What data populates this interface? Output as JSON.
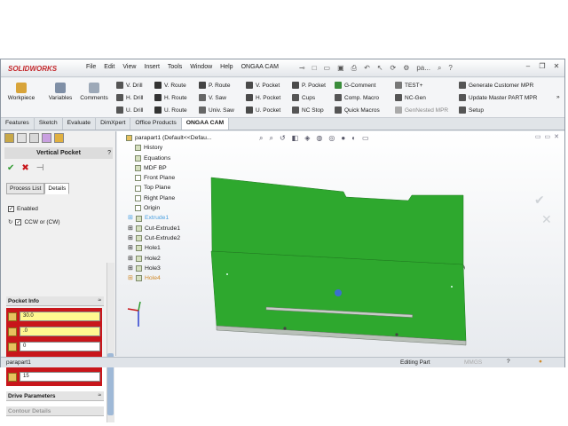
{
  "app": {
    "logo_text": "SOLIDWORKS",
    "doc_short": "pa..."
  },
  "menu": [
    "File",
    "Edit",
    "View",
    "Insert",
    "Tools",
    "Window",
    "Help",
    "ONGAA CAM"
  ],
  "ribbon": {
    "big": [
      {
        "label": "Workpiece",
        "icon": "workpiece-icon"
      },
      {
        "label": "Variables",
        "icon": "variables-icon"
      },
      {
        "label": "Comments",
        "icon": "comments-icon"
      }
    ],
    "col1": [
      "V. Drill",
      "H. Drill",
      "U. Drill"
    ],
    "col2": [
      "V. Route",
      "H. Route",
      "U. Route"
    ],
    "col3": [
      "P. Route",
      "V. Saw",
      "Univ. Saw"
    ],
    "col4": [
      "V. Pocket",
      "H. Pocket",
      "U. Pocket"
    ],
    "col5": [
      "P. Pocket",
      "Cups",
      "NC Stop"
    ],
    "col6": [
      "G-Comment",
      "Comp. Macro",
      "Quick Macros"
    ],
    "col7": [
      "TEST+",
      "NC-Gen",
      "GenNested MPR"
    ],
    "col8": [
      "Generate Customer MPR",
      "Update Master PART MPR",
      "Setup"
    ]
  },
  "tabs": [
    "Features",
    "Sketch",
    "Evaluate",
    "DimXpert",
    "Office Products",
    "ONGAA CAM"
  ],
  "panel": {
    "title": "Vertical Pocket",
    "help": "?",
    "subtabs": [
      "Process List",
      "Details"
    ],
    "enabled_label": "Enabled",
    "ccw_label": "CCW or (CW)",
    "pocket_info": "Pocket Info",
    "fields": [
      "30.0",
      ".0",
      "0",
      "80",
      "15"
    ],
    "drive_params": "Drive Parameters",
    "contour_details": "Contour Details"
  },
  "tree": {
    "root": "parapart1  (Default<<Defau...",
    "items": [
      "History",
      "Equations",
      "MDF BP",
      "Front Plane",
      "Top Plane",
      "Right Plane",
      "Origin",
      "Extrude1",
      "Cut-Extrude1",
      "Cut-Extrude2",
      "Hole1",
      "Hole2",
      "Hole3",
      "Hole4"
    ]
  },
  "status": {
    "left": "parapart1",
    "mode": "Editing Part",
    "units": "MMGS"
  },
  "colors": {
    "board": "#2ea82e",
    "board_edge": "#8f9a8f",
    "red": "#c8161b",
    "accent": "#c3272b"
  }
}
